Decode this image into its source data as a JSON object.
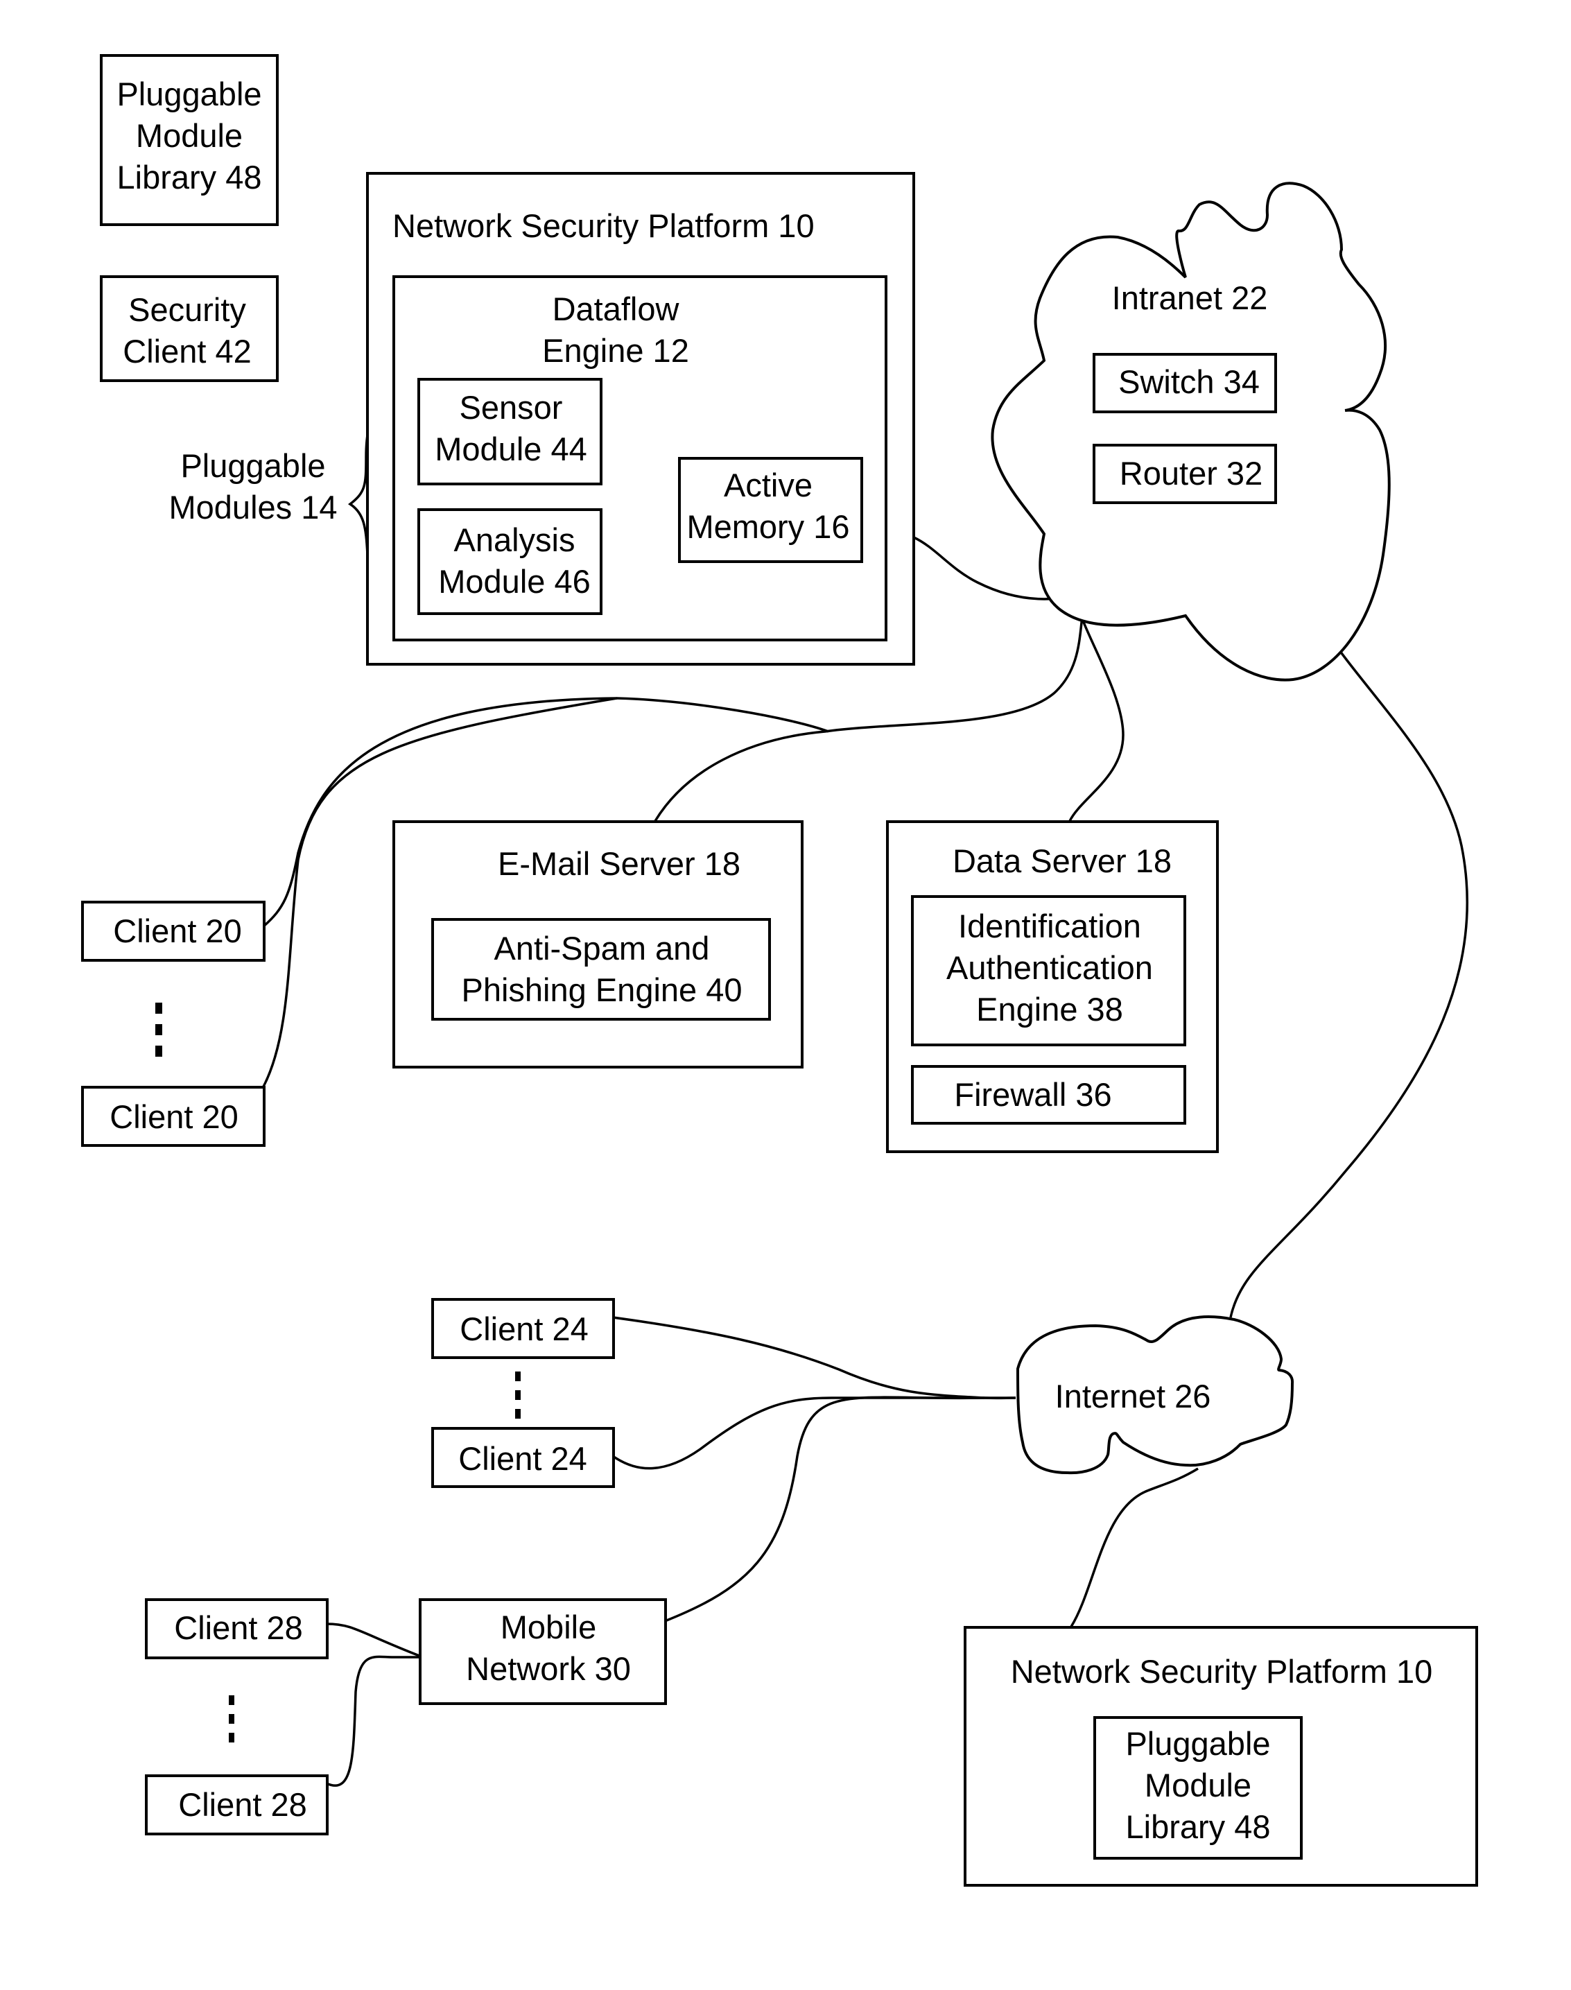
{
  "diagram": {
    "top_left": {
      "pluggable_module_library": [
        "Pluggable",
        "Module",
        "Library 48"
      ],
      "security_client": [
        "Security",
        "Client 42"
      ],
      "pluggable_modules_label": [
        "Pluggable",
        "Modules 14"
      ]
    },
    "network_security_platform_main": {
      "title": "Network Security Platform 10",
      "dataflow_engine": [
        "Dataflow",
        "Engine 12"
      ],
      "sensor_module": [
        "Sensor",
        "Module 44"
      ],
      "analysis_module": [
        "Analysis",
        "Module 46"
      ],
      "active_memory": [
        "Active",
        "Memory 16"
      ]
    },
    "intranet": {
      "title": "Intranet 22",
      "switch": "Switch 34",
      "router": "Router 32"
    },
    "clients_20": [
      "Client 20",
      "Client 20"
    ],
    "email_server": {
      "title": "E-Mail Server 18",
      "engine": [
        "Anti-Spam and",
        "Phishing Engine 40"
      ]
    },
    "data_server": {
      "title": "Data Server 18",
      "engine": [
        "Identification",
        "Authentication",
        "Engine 38"
      ],
      "firewall": "Firewall 36"
    },
    "clients_24": [
      "Client 24",
      "Client 24"
    ],
    "internet": {
      "title": "Internet 26"
    },
    "clients_28": [
      "Client 28",
      "Client 28"
    ],
    "mobile_network": [
      "Mobile",
      "Network 30"
    ],
    "network_security_platform_remote": {
      "title": "Network Security Platform 10",
      "library": [
        "Pluggable",
        "Module",
        "Library 48"
      ]
    }
  }
}
